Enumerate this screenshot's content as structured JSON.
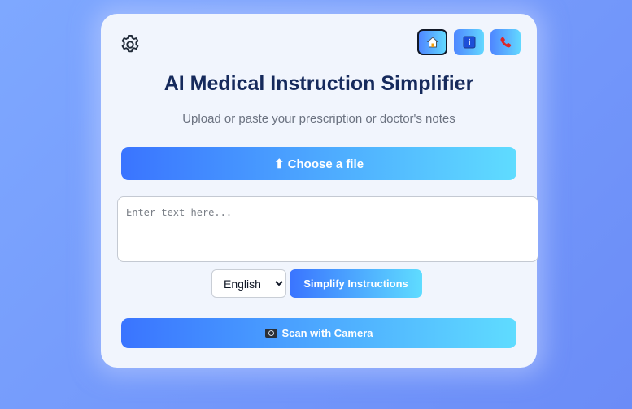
{
  "app": {
    "title": "AI Medical Instruction Simplifier",
    "subtitle": "Upload or paste your prescription or doctor's notes"
  },
  "nav": {
    "settings_icon": "gear-icon",
    "items": [
      {
        "icon": "home-icon",
        "active": true
      },
      {
        "icon": "info-icon",
        "active": false
      },
      {
        "icon": "phone-icon",
        "active": false
      }
    ]
  },
  "upload": {
    "label": "⬆ Choose a file"
  },
  "input": {
    "placeholder": "Enter text here...",
    "value": ""
  },
  "language": {
    "selected": "English"
  },
  "actions": {
    "simplify_label": "Simplify Instructions",
    "scan_label": "Scan with Camera",
    "scan_icon": "camera-icon"
  },
  "colors": {
    "accent_start": "#3a74ff",
    "accent_end": "#5fdcff",
    "title_color": "#162a5c",
    "background": "#7ea8ff"
  }
}
